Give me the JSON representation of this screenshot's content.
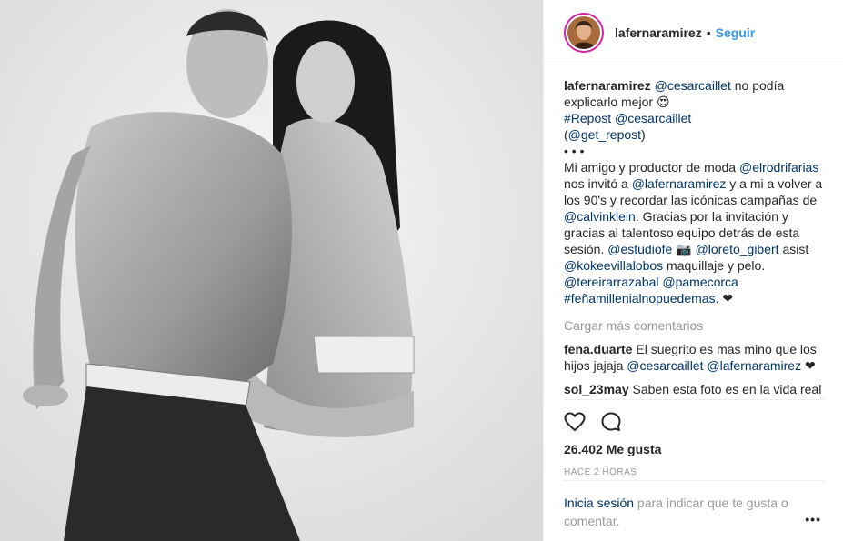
{
  "post": {
    "username": "lafernaramirez",
    "separator": "•",
    "follow_label": "Seguir",
    "image_description_alt": "",
    "caption": {
      "username": "lafernaramirez",
      "mention1": "@cesarcaillet",
      "text1": " no podía explicarlo mejor ",
      "emoji1": "😍",
      "repost_tag": "#Repost",
      "repost_user": "@cesarcaillet",
      "open_paren": "(",
      "get_repost": "@get_repost",
      "close_paren": ")",
      "dots": "• • •",
      "text2": "Mi amigo y productor de moda ",
      "mention_elrodri": "@elrodrifarias",
      "text3": " nos invitó a ",
      "mention_lafer": "@lafernaramirez",
      "text4": " y a mi a volver a los 90's y recordar las icónicas campañas de ",
      "mention_ck": "@calvinklein",
      "text5": ". Gracias por la invitación y gracias al talentoso equipo detrás de esta sesión. ",
      "mention_estudio": "@estudiofe",
      "camera": "📷",
      "mention_loreto": "@loreto_gibert",
      "text6": " asist ",
      "mention_kokee": "@kokeevillalobos",
      "text7": " maquillaje y pelo. ",
      "mention_tere": "@tereirarrazabal",
      "mention_pame": "@pamecorca",
      "tag_fena": "#feñamillenialnopuedemas",
      "text8": ". ",
      "heart": "❤"
    },
    "load_more": "Cargar más comentarios",
    "comments": [
      {
        "user": "fena.duarte",
        "text_a": " El suegrito es mas mino que los hijos jajaja ",
        "m1": "@cesarcaillet",
        "m2": "@lafernaramirez",
        "tail": " ❤"
      },
      {
        "user": "sol_23may",
        "text": " Saben esta foto es en la vida real fernanda es la actriz que interpreta a"
      }
    ],
    "likes": "26.402 Me gusta",
    "time_ago": "HACE 2 HORAS",
    "login_link": "Inicia sesión",
    "login_text": " para indicar que te gusta o comentar.",
    "more_icon": "•••"
  },
  "icons": {
    "like": "heart-outline-icon",
    "comment": "comment-bubble-icon"
  }
}
